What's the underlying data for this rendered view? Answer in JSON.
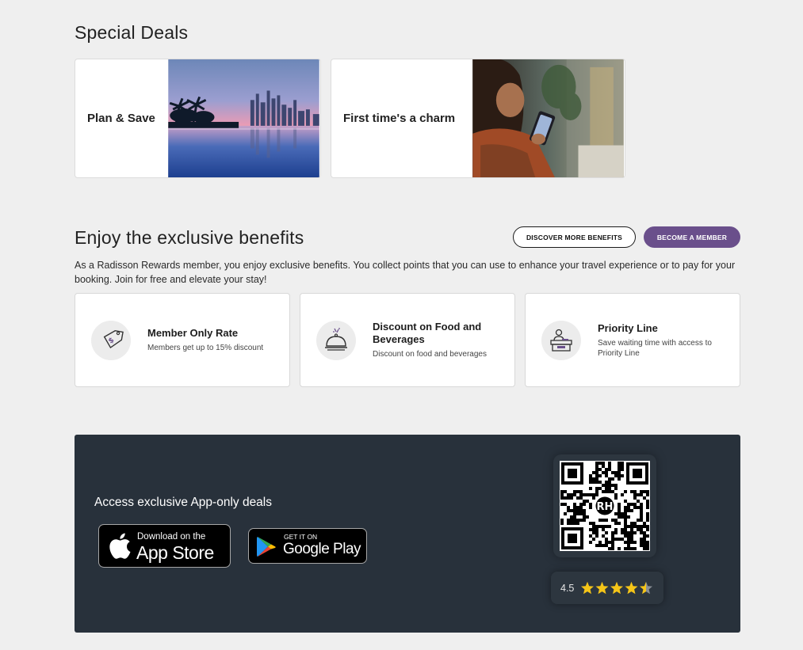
{
  "special_deals": {
    "title": "Special Deals",
    "cards": [
      {
        "label": "Plan & Save"
      },
      {
        "label": "First time's a charm"
      }
    ]
  },
  "benefits": {
    "title": "Enjoy the exclusive benefits",
    "discover_button": "DISCOVER MORE BENEFITS",
    "member_button": "BECOME A MEMBER",
    "intro": "As a Radisson Rewards member, you enjoy exclusive benefits. You collect points that you can use to enhance your travel experience or to pay for your booking. Join for free and elevate your stay!",
    "items": [
      {
        "title": "Member Only Rate",
        "desc": "Members get up to 15% discount",
        "icon": "price-tag-icon"
      },
      {
        "title": "Discount on Food and Beverages",
        "desc": "Discount on food and beverages",
        "icon": "food-cloche-icon"
      },
      {
        "title": "Priority Line",
        "desc": "Save waiting time with access to Priority Line",
        "icon": "reception-desk-icon"
      }
    ]
  },
  "app": {
    "heading": "Access exclusive App-only deals",
    "app_store": {
      "small": "Download on the",
      "big": "App Store"
    },
    "google_play": {
      "small": "GET IT ON",
      "big": "Google Play"
    },
    "qr_logo_text": "RH",
    "rating": "4.5",
    "rating_stars": 4.5
  },
  "colors": {
    "accent": "#6a4f8b",
    "banner_bg": "#28313b",
    "star": "#f5c518",
    "page_bg": "#efefef"
  }
}
